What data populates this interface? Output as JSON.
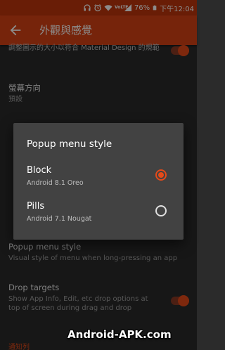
{
  "status_bar": {
    "battery": "76%",
    "time": "下午12:04",
    "volte": "VoLTE",
    "icons": [
      "headphones-icon",
      "alarm-icon",
      "wifi-icon",
      "volte-icon",
      "signal-icon",
      "battery-icon"
    ]
  },
  "toolbar": {
    "title": "外觀與感覺",
    "back_icon": "back-arrow-icon"
  },
  "settings": {
    "icon_shape_summary": "調整圖示的大小以符合 Material Design 的規範",
    "orientation": {
      "title": "螢幕方向",
      "summary": "預設"
    },
    "popup_menu_style": {
      "title": "Popup menu style",
      "summary": "Visual style of menu when long-pressing an app"
    },
    "drop_targets": {
      "title": "Drop targets",
      "summary": "Show App Info, Edit, etc drop options at top of screen during drag and drop"
    },
    "section_partial": "通知列"
  },
  "dialog": {
    "title": "Popup menu style",
    "options": [
      {
        "label": "Block",
        "sublabel": "Android 8.1 Oreo",
        "selected": true
      },
      {
        "label": "Pills",
        "sublabel": "Android 7.1 Nougat",
        "selected": false
      }
    ]
  },
  "watermark": "Android-APK.com",
  "colors": {
    "accent": "#e64a19",
    "toolbar": "#d84315",
    "status_bar": "#bf360c",
    "background": "#2b2b2b",
    "dialog": "#424242"
  }
}
